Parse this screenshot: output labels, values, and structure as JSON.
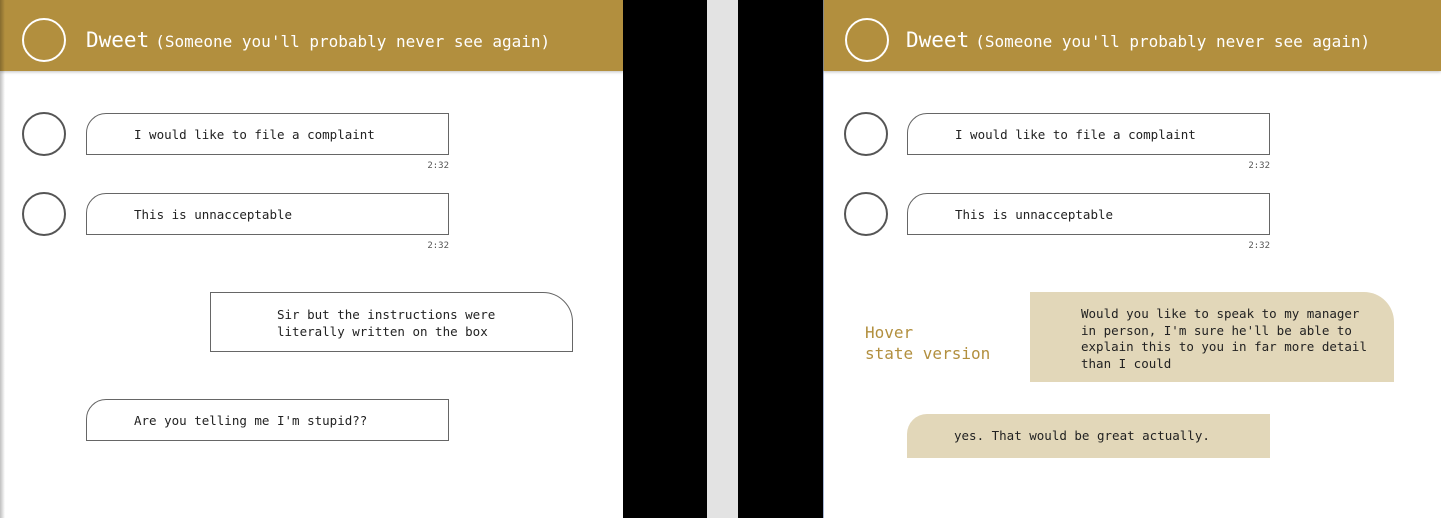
{
  "header": {
    "name": "Dweet",
    "subtitle": "(Someone you'll probably never see again)"
  },
  "left_panel": {
    "messages": [
      {
        "text": "I would like to file a complaint",
        "time": "2:32"
      },
      {
        "text": "This is unnacceptable",
        "time": "2:32"
      },
      {
        "text": "Sir but the instructions were\nliterally written on the box"
      },
      {
        "text": "Are you telling me I'm stupid??"
      }
    ]
  },
  "right_panel": {
    "messages": [
      {
        "text": "I would like to file a complaint",
        "time": "2:32"
      },
      {
        "text": "This is unnacceptable",
        "time": "2:32"
      },
      {
        "text": "Would you like to speak to my manager\nin person, I'm sure he'll be able to\nexplain this to you in far more detail\nthan I could"
      },
      {
        "text": "yes. That would be great actually."
      }
    ],
    "hover_label": "Hover\nstate version"
  },
  "colors": {
    "header_bg": "#b28f3e",
    "hover_bubble_bg": "#e2d7b9",
    "divider_black": "#000000",
    "page_bg": "#ffffff"
  }
}
